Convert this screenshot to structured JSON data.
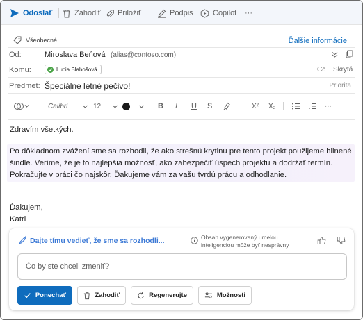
{
  "toolbar": {
    "send_label": "Odoslať",
    "discard_label": "Zahodiť",
    "attach_label": "Priložiť",
    "signature_label": "Podpis",
    "copilot_label": "Copilot",
    "more_label": "···"
  },
  "header": {
    "sensitivity": "Všeobecné",
    "more_info": "Ďalšie informácie",
    "from_label": "Od:",
    "from_name": "Miroslava Beňová",
    "from_email": "(alias@contoso.com)",
    "to_label": "Komu:",
    "recipient": "Lucia Blahošová",
    "cc": "Cc",
    "bcc": "Skrytá",
    "subject_label": "Predmet:",
    "subject": "Špeciálne letné pečivo!",
    "priority": "Priorita"
  },
  "format": {
    "font": "Calibri",
    "size": "12",
    "bold": "B",
    "italic": "I",
    "underline": "U",
    "strike": "S",
    "superscript": "X²",
    "subscript": "X₂",
    "more": "···"
  },
  "body": {
    "greeting": "Zdravím všetkých.",
    "para_line1": "Po dôkladnom zvážení sme sa rozhodli, že ako strešnú krytinu pre tento projekt použijeme hlinené",
    "para_line2": "šindle. Veríme, že je to najlepšia možnosť, ako zabezpečiť úspech projektu a dodržať termín.",
    "para_line3": "Pokračujte v práci čo najskôr. Ďakujeme vám za vašu tvrdú prácu a odhodlanie.",
    "closing": "Ďakujem,",
    "signature": "Katri"
  },
  "copilot": {
    "title": "Dajte tímu vedieť, že sme sa rozhodli...",
    "disclaimer_line1": "Obsah vygenerovaný umelou",
    "disclaimer_line2": "inteligenciou môže byť nesprávny",
    "input_placeholder": "Čo by ste chceli zmeniť?",
    "keep_label": "Ponechať",
    "discard_label": "Zahodiť",
    "regenerate_label": "Regenerujte",
    "options_label": "Možnosti"
  },
  "colors": {
    "accent": "#0f6cbd",
    "copilot_title": "#3d7ad6",
    "toolbar_bg": "#f3f6fb"
  }
}
